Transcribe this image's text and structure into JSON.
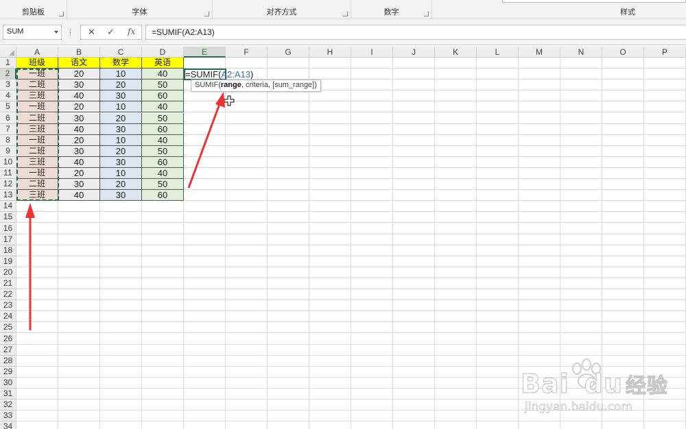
{
  "ribbon": {
    "groups": [
      {
        "label": "剪贴板"
      },
      {
        "label": "字体"
      },
      {
        "label": "对齐方式"
      },
      {
        "label": "数字"
      },
      {
        "label": ""
      },
      {
        "label": "样式"
      }
    ]
  },
  "formula_bar": {
    "name_box": "SUM",
    "cancel_icon": "✕",
    "enter_icon": "✓",
    "fx_icon": "fx",
    "formula": "=SUMIF(A2:A13)"
  },
  "columns": [
    "A",
    "B",
    "C",
    "D",
    "E",
    "F",
    "G",
    "H",
    "I",
    "J",
    "K",
    "L",
    "M",
    "N",
    "O",
    "P"
  ],
  "rows": [
    "1",
    "2",
    "3",
    "4",
    "5",
    "6",
    "7",
    "8",
    "9",
    "10",
    "11",
    "12",
    "13",
    "14",
    "15",
    "16",
    "17",
    "18",
    "19",
    "20",
    "21",
    "22",
    "23",
    "24",
    "25",
    "26",
    "27",
    "28",
    "29",
    "30",
    "31",
    "32",
    "33",
    "34"
  ],
  "table": {
    "headers": [
      "班级",
      "语文",
      "数学",
      "英语"
    ],
    "header_color": "#ffff00",
    "col_colors": [
      "#ecdcd2",
      "#ededed",
      "#dce6f1",
      "#e2efda"
    ],
    "rows": [
      [
        "一班",
        "20",
        "10",
        "40"
      ],
      [
        "二班",
        "30",
        "20",
        "50"
      ],
      [
        "三班",
        "40",
        "30",
        "60"
      ],
      [
        "一班",
        "20",
        "10",
        "40"
      ],
      [
        "二班",
        "30",
        "20",
        "50"
      ],
      [
        "三班",
        "40",
        "30",
        "60"
      ],
      [
        "一班",
        "20",
        "10",
        "40"
      ],
      [
        "二班",
        "30",
        "20",
        "50"
      ],
      [
        "三班",
        "40",
        "30",
        "60"
      ],
      [
        "一班",
        "20",
        "10",
        "40"
      ],
      [
        "二班",
        "30",
        "20",
        "50"
      ],
      [
        "三班",
        "40",
        "30",
        "60"
      ]
    ]
  },
  "active_cell": {
    "text_prefix": "=SUMIF(",
    "text_ref": "A2:A13",
    "text_suffix": ")"
  },
  "tooltip": {
    "fn": "SUMIF(",
    "arg_bold": "range",
    "rest": ", criteria, [sum_range])"
  },
  "watermark": {
    "brand": "Bai",
    "brand2": "du",
    "cn": "经验",
    "url": "jingyan.baidu.com"
  },
  "colors": {
    "accent": "#217346",
    "arrow": "#ee3333"
  }
}
